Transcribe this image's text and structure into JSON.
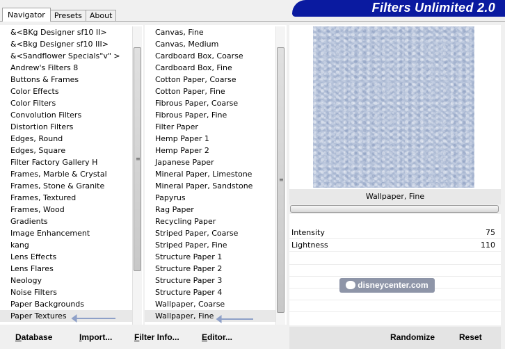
{
  "brand_title": "Filters Unlimited 2.0",
  "tabs": [
    {
      "label": "Navigator",
      "active": true
    },
    {
      "label": "Presets",
      "active": false
    },
    {
      "label": "About",
      "active": false
    }
  ],
  "categories": [
    "&<BKg Designer sf10 II>",
    "&<Bkg Designer sf10 III>",
    "&<Sandflower Specials\"v\" >",
    "Andrew's Filters 8",
    "Buttons & Frames",
    "Color Effects",
    "Color Filters",
    "Convolution Filters",
    "Distortion Filters",
    "Edges, Round",
    "Edges, Square",
    "Filter Factory Gallery H",
    "Frames, Marble & Crystal",
    "Frames, Stone & Granite",
    "Frames, Textured",
    "Frames, Wood",
    "Gradients",
    "Image Enhancement",
    "kang",
    "Lens Effects",
    "Lens Flares",
    "Neology",
    "Noise Filters",
    "Paper Backgrounds",
    "Paper Textures"
  ],
  "selected_category": "Paper Textures",
  "filters": [
    "Canvas, Fine",
    "Canvas, Medium",
    "Cardboard Box, Coarse",
    "Cardboard Box, Fine",
    "Cotton Paper, Coarse",
    "Cotton Paper, Fine",
    "Fibrous Paper, Coarse",
    "Fibrous Paper, Fine",
    "Filter Paper",
    "Hemp Paper 1",
    "Hemp Paper 2",
    "Japanese Paper",
    "Mineral Paper, Limestone",
    "Mineral Paper, Sandstone",
    "Papyrus",
    "Rag Paper",
    "Recycling Paper",
    "Striped Paper, Coarse",
    "Striped Paper, Fine",
    "Structure Paper 1",
    "Structure Paper 2",
    "Structure Paper 3",
    "Structure Paper 4",
    "Wallpaper, Coarse",
    "Wallpaper, Fine"
  ],
  "selected_filter": "Wallpaper, Fine",
  "preview": {
    "filter_name": "Wallpaper, Fine",
    "texture_color": "#b7c4dc"
  },
  "params": [
    {
      "label": "Intensity",
      "value": "75"
    },
    {
      "label": "Lightness",
      "value": "110"
    }
  ],
  "watermark": "disneycenter.com",
  "buttons": {
    "database": {
      "first": "D",
      "rest": "atabase"
    },
    "import": {
      "first": "I",
      "rest": "mport..."
    },
    "filter_info": {
      "first": "F",
      "rest": "ilter Info..."
    },
    "editor": {
      "first": "E",
      "rest": "ditor..."
    },
    "randomize": "Randomize",
    "reset": "Reset"
  },
  "colors": {
    "brand_bg": "#0a1aa0",
    "arrow_hint": "#8ea0c8"
  }
}
